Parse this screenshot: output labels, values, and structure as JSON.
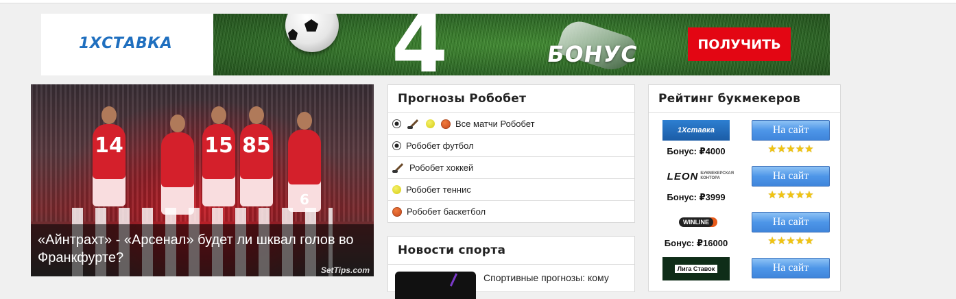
{
  "banner": {
    "brand": "1XСТАВКА",
    "digit": "4",
    "bonus_text": "БОНУС",
    "button": "ПОЛУЧИТЬ"
  },
  "featured": {
    "title": "«Айнтрахт» - «Арсенал» будет ли шквал голов во Франкфурте?",
    "watermark": "SetTips.com",
    "jersey_numbers": [
      "14",
      "15",
      "85",
      "6"
    ]
  },
  "robobet": {
    "title": "Прогнозы Робобет",
    "items": [
      {
        "label": "Все матчи Робобет",
        "icons": [
          "soccer-ball-icon",
          "hockey-stick-icon",
          "tennis-ball-icon",
          "basketball-icon"
        ]
      },
      {
        "label": "Робобет футбол",
        "icons": [
          "soccer-ball-icon"
        ]
      },
      {
        "label": "Робобет хоккей",
        "icons": [
          "hockey-stick-icon"
        ]
      },
      {
        "label": "Робобет теннис",
        "icons": [
          "tennis-ball-icon"
        ]
      },
      {
        "label": "Робобет баскетбол",
        "icons": [
          "basketball-icon"
        ]
      }
    ]
  },
  "news": {
    "title": "Новости спорта",
    "first_item_text": "Спортивные прогнозы: кому"
  },
  "rating": {
    "title": "Рейтинг букмекеров",
    "bookmakers": [
      {
        "logo_text": "1Xставка",
        "bonus": "Бонус: ₽4000",
        "button": "На сайт",
        "stars": "★★★★★",
        "rating": 5
      },
      {
        "logo_text": "LEON",
        "logo_sub": "БУКМЕКЕРСКАЯ КОНТОРА",
        "bonus": "Бонус: ₽3999",
        "button": "На сайт",
        "stars": "★★★★★",
        "rating": 5
      },
      {
        "logo_text": "WINLINE",
        "bonus": "Бонус: ₽16000",
        "button": "На сайт",
        "stars": "★★★★★",
        "rating": 5
      },
      {
        "logo_text": "Лига Ставок",
        "button": "На сайт"
      }
    ]
  },
  "colors": {
    "banner_button": "#e30613",
    "brand_blue": "#1f6fbf",
    "site_button": "#4e96e8",
    "star": "#f1c40f"
  }
}
